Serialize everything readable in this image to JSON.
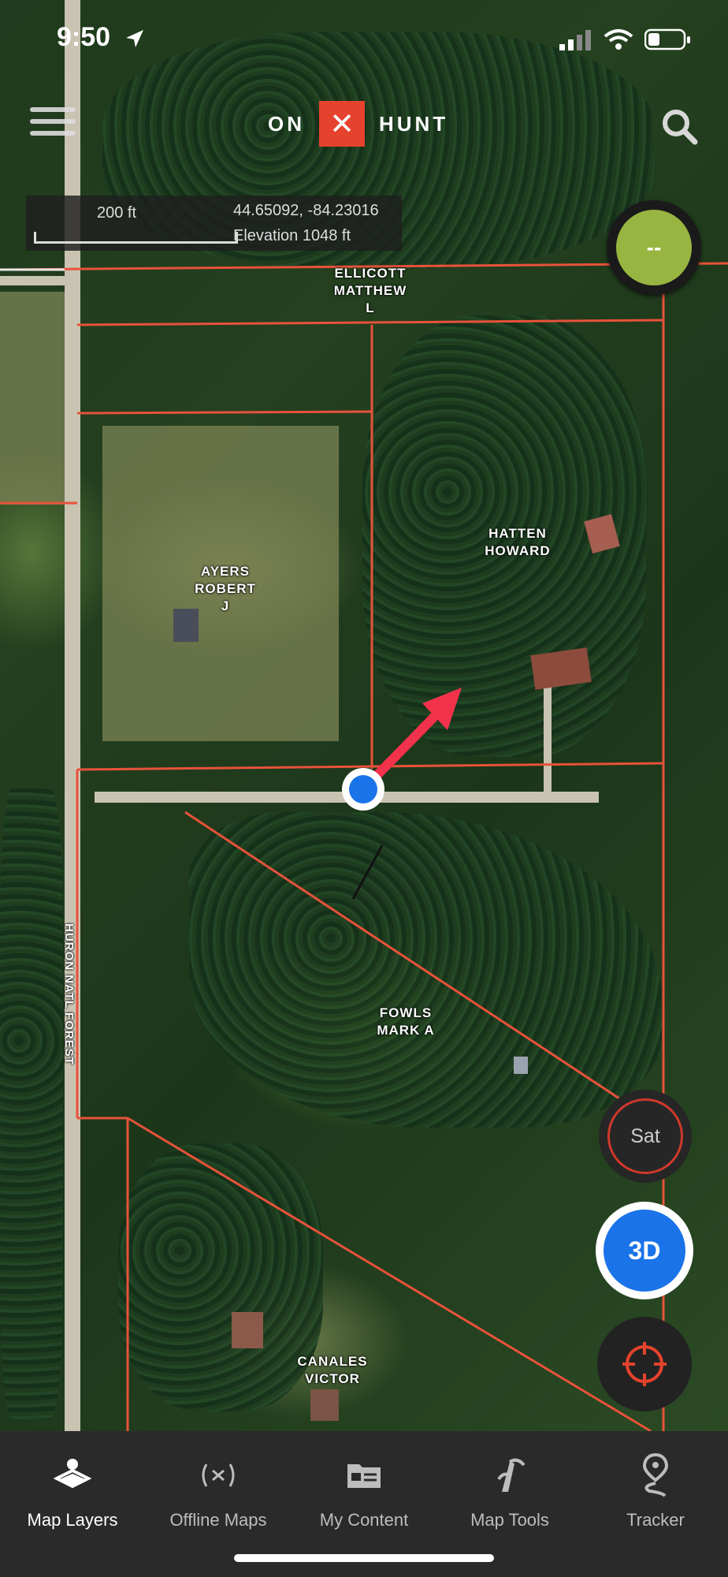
{
  "status_bar": {
    "time": "9:50"
  },
  "header": {
    "logo_left": "ON",
    "logo_mark": "✕",
    "logo_right": "HUNT"
  },
  "scale": {
    "distance": "200 ft",
    "coordinates": "44.65092, -84.23016",
    "elevation": "Elevation 1048 ft"
  },
  "gps_button": {
    "label": "--"
  },
  "map": {
    "parcels": [
      {
        "owner": "ELLICOTT\nMATTHEW\nL"
      },
      {
        "owner": "HATTEN\nHOWARD"
      },
      {
        "owner": "AYERS\nROBERT\nJ"
      },
      {
        "owner": "FOWLS\nMARK A"
      },
      {
        "owner": "CANALES\nVICTOR"
      }
    ],
    "forest_label": "HURON NATL FOREST"
  },
  "map_controls": {
    "layer_toggle": "Sat",
    "mode_toggle": "3D"
  },
  "tabs": [
    {
      "label": "Map Layers",
      "icon": "map-layers-icon"
    },
    {
      "label": "Offline Maps",
      "icon": "offline-maps-icon"
    },
    {
      "label": "My Content",
      "icon": "my-content-icon"
    },
    {
      "label": "Map Tools",
      "icon": "map-tools-icon"
    },
    {
      "label": "Tracker",
      "icon": "tracker-icon"
    }
  ],
  "colors": {
    "parcel_line": "#e8523a",
    "logo_red": "#e5432d",
    "gps_green": "#97b540",
    "button_blue": "#1a73e8",
    "heading_arrow": "#f2314b"
  }
}
